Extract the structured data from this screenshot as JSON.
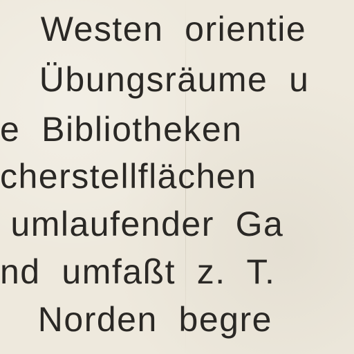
{
  "document": {
    "lines": [
      "  Westen  orientie",
      "  Übungsräume  u",
      "e  Bibliotheken",
      "cherstellflächen",
      " umlaufender  Ga",
      "nd  umfaßt  z.  T.",
      "  Norden  begre"
    ]
  }
}
